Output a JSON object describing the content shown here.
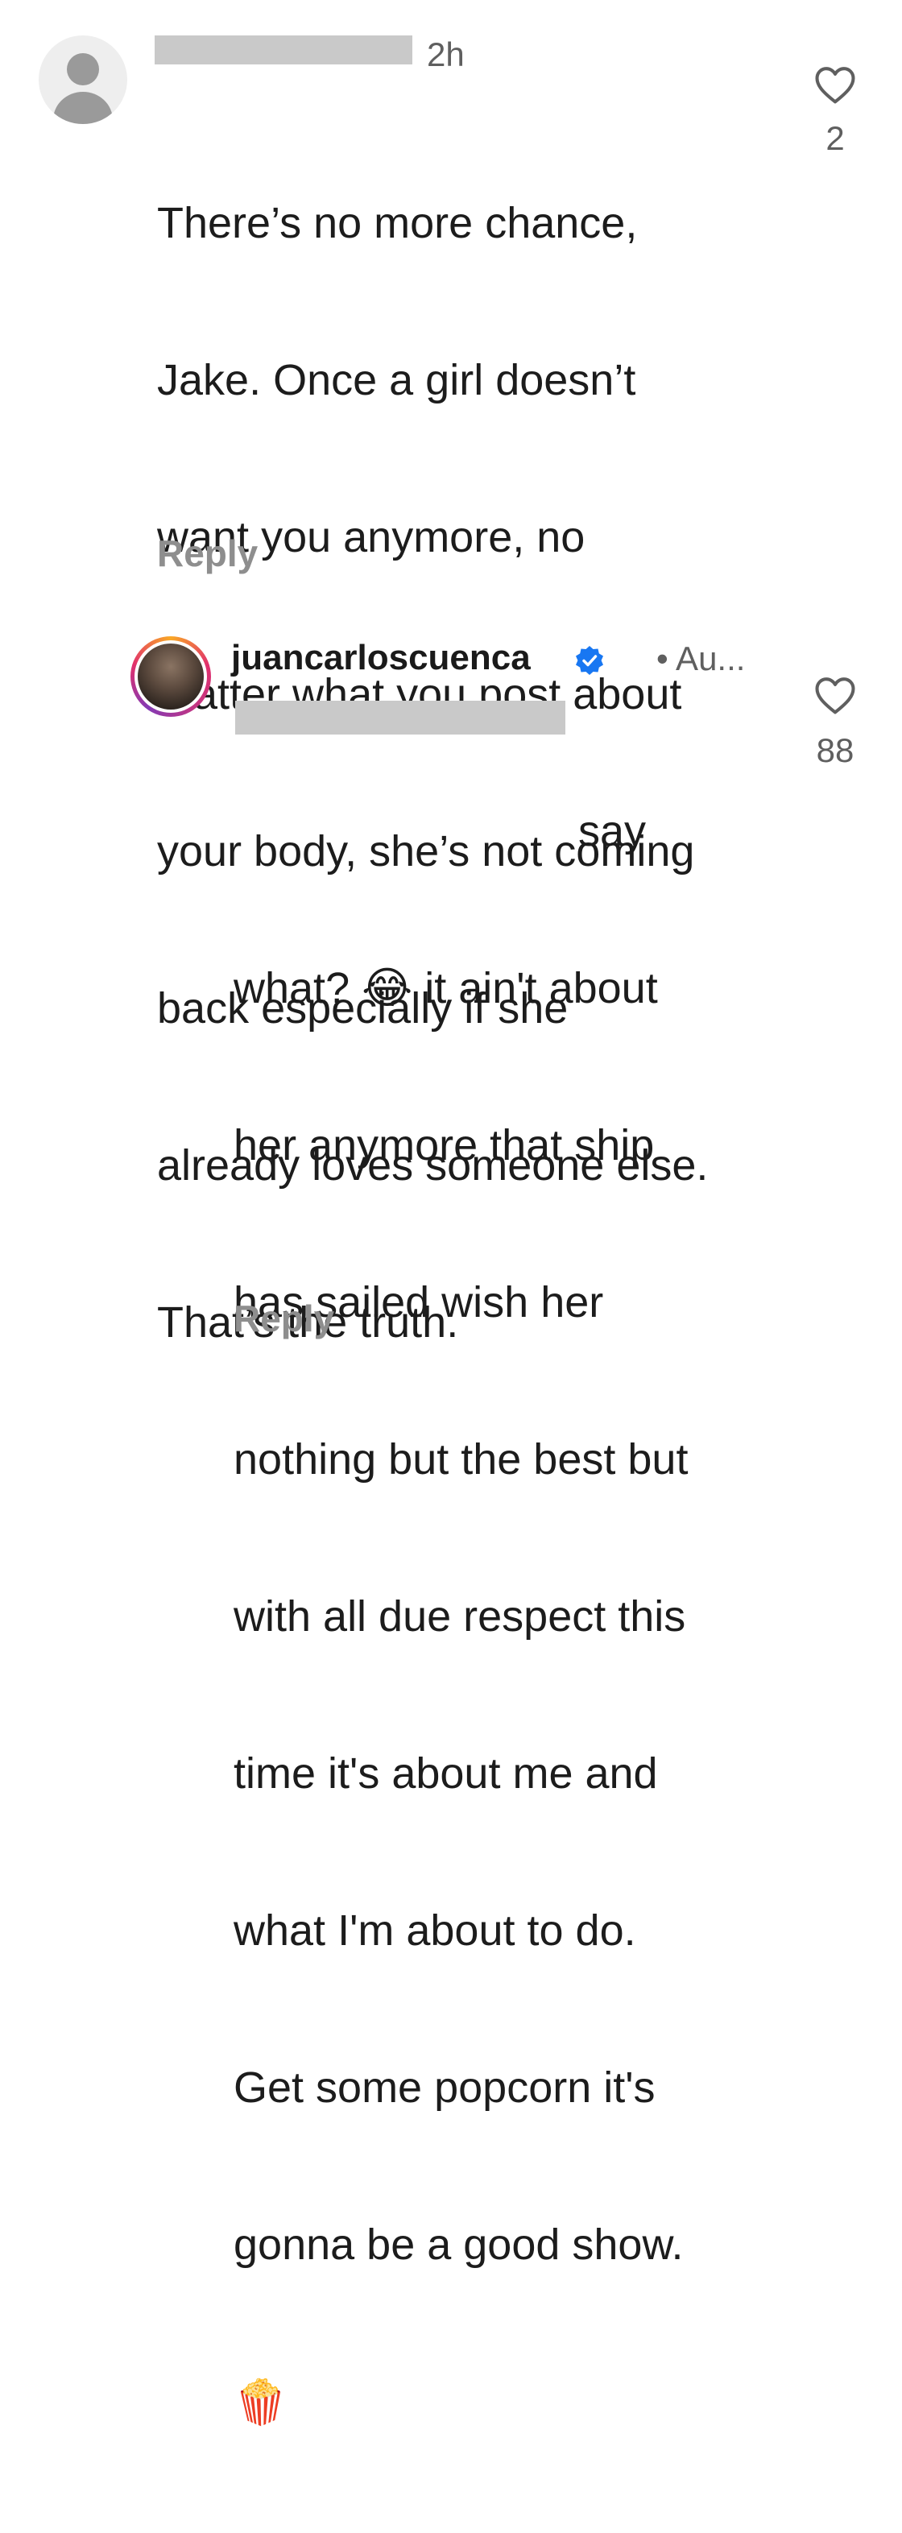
{
  "comments": [
    {
      "time": "2h",
      "lines": [
        "There’s no more chance,",
        "Jake. Once a girl doesn’t",
        "want you anymore, no",
        "matter what you post about",
        "your body, she’s not coming",
        "back especially if she",
        "already loves someone else.",
        "That’s the truth."
      ],
      "reply_label": "Reply",
      "likes": "2",
      "icons": {
        "avatar": "default-avatar-icon",
        "like": "heart-icon"
      }
    },
    {
      "username": "juancarloscuenca",
      "time": "• Au...",
      "lines": [
        "say",
        "what? 😂 it ain't about",
        "her anymore that ship",
        "has sailed wish her",
        "nothing but the best but",
        "with all due respect this",
        "time it's about me and",
        "what I'm about to do.",
        "Get some popcorn it's",
        "gonna be a good show.",
        "🍿"
      ],
      "reply_label": "Reply",
      "likes": "88",
      "icons": {
        "verified": "verified-badge-icon",
        "like": "heart-icon"
      },
      "colors": {
        "verified": "#1877f2"
      }
    }
  ]
}
